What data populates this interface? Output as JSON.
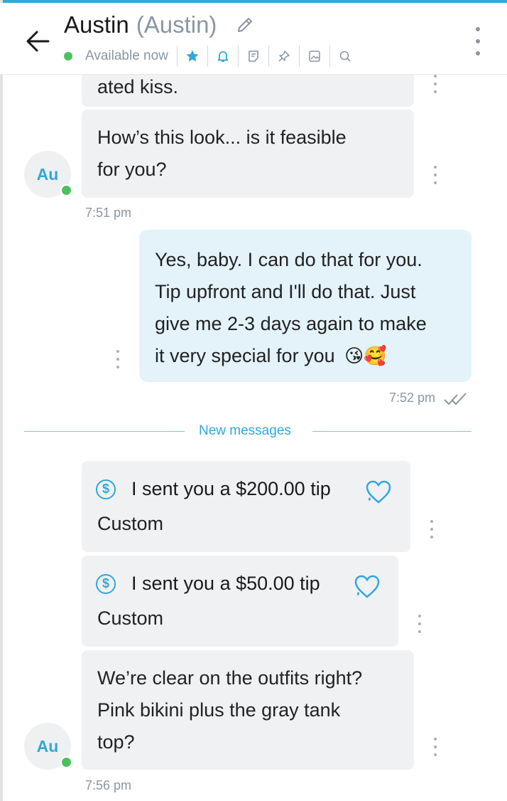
{
  "header": {
    "name": "Austin",
    "alias": "(Austin)",
    "status": "Available now",
    "tools": [
      "star-icon",
      "bell-icon",
      "note-icon",
      "pin-icon",
      "image-icon",
      "search-icon"
    ]
  },
  "colors": {
    "accent": "#2fa8dc",
    "online": "#4cc15e",
    "muted": "#8a96a3"
  },
  "messages": {
    "m0": {
      "text": "ated kiss."
    },
    "m1": {
      "line1": "How’s this look... is it feasible",
      "line2": "for you?",
      "time": "7:51 pm",
      "avatar": "Au"
    },
    "m2": {
      "line1": "Yes, baby. I can do that for you.",
      "line2": "Tip upfront and I'll do that. Just",
      "line3": "give me 2-3 days again to make",
      "line4": "it very special for you",
      "emoji": "😘🥰",
      "time": "7:52 pm"
    },
    "divider": "New messages",
    "tip1": {
      "label": "I sent you a $200.00 tip",
      "subtitle": "Custom"
    },
    "tip2": {
      "label": "I sent you a $50.00 tip",
      "subtitle": "Custom"
    },
    "m3": {
      "line1": "We’re clear on the outfits right?",
      "line2": "Pink bikini plus the gray tank",
      "line3": "top?",
      "time": "7:56 pm",
      "avatar": "Au"
    }
  },
  "dollar_symbol": "$"
}
